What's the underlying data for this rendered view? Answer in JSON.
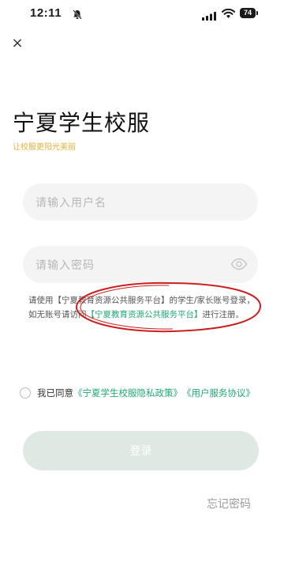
{
  "status_bar": {
    "time": "12:11",
    "battery": "74",
    "icons": [
      "bell-mute-icon",
      "signal-icon",
      "wifi-icon",
      "battery-icon"
    ]
  },
  "header": {
    "close_icon": "×"
  },
  "app": {
    "title": "宁夏学生校服",
    "subtitle": "让校服更阳光美丽"
  },
  "form": {
    "username_placeholder": "请输入用户名",
    "password_placeholder": "请输入密码"
  },
  "info": {
    "prefix": "请使用【宁夏教育资源公共服务平台】的学生/家长账号登录，如无账号请访问",
    "link": "【宁夏教育资源公共服务平台】",
    "suffix": "进行注册。"
  },
  "agreement": {
    "prefix": "我已同意",
    "privacy_link": "《宁夏学生校服隐私政策》",
    "terms_link": "《用户服务协议》"
  },
  "login_button": "登录",
  "forgot_password": "忘记密码",
  "colors": {
    "accent": "#20a874",
    "subtitle": "#e3b13c",
    "button_disabled": "#dfe9e4",
    "annotation": "#cc1f1f"
  }
}
